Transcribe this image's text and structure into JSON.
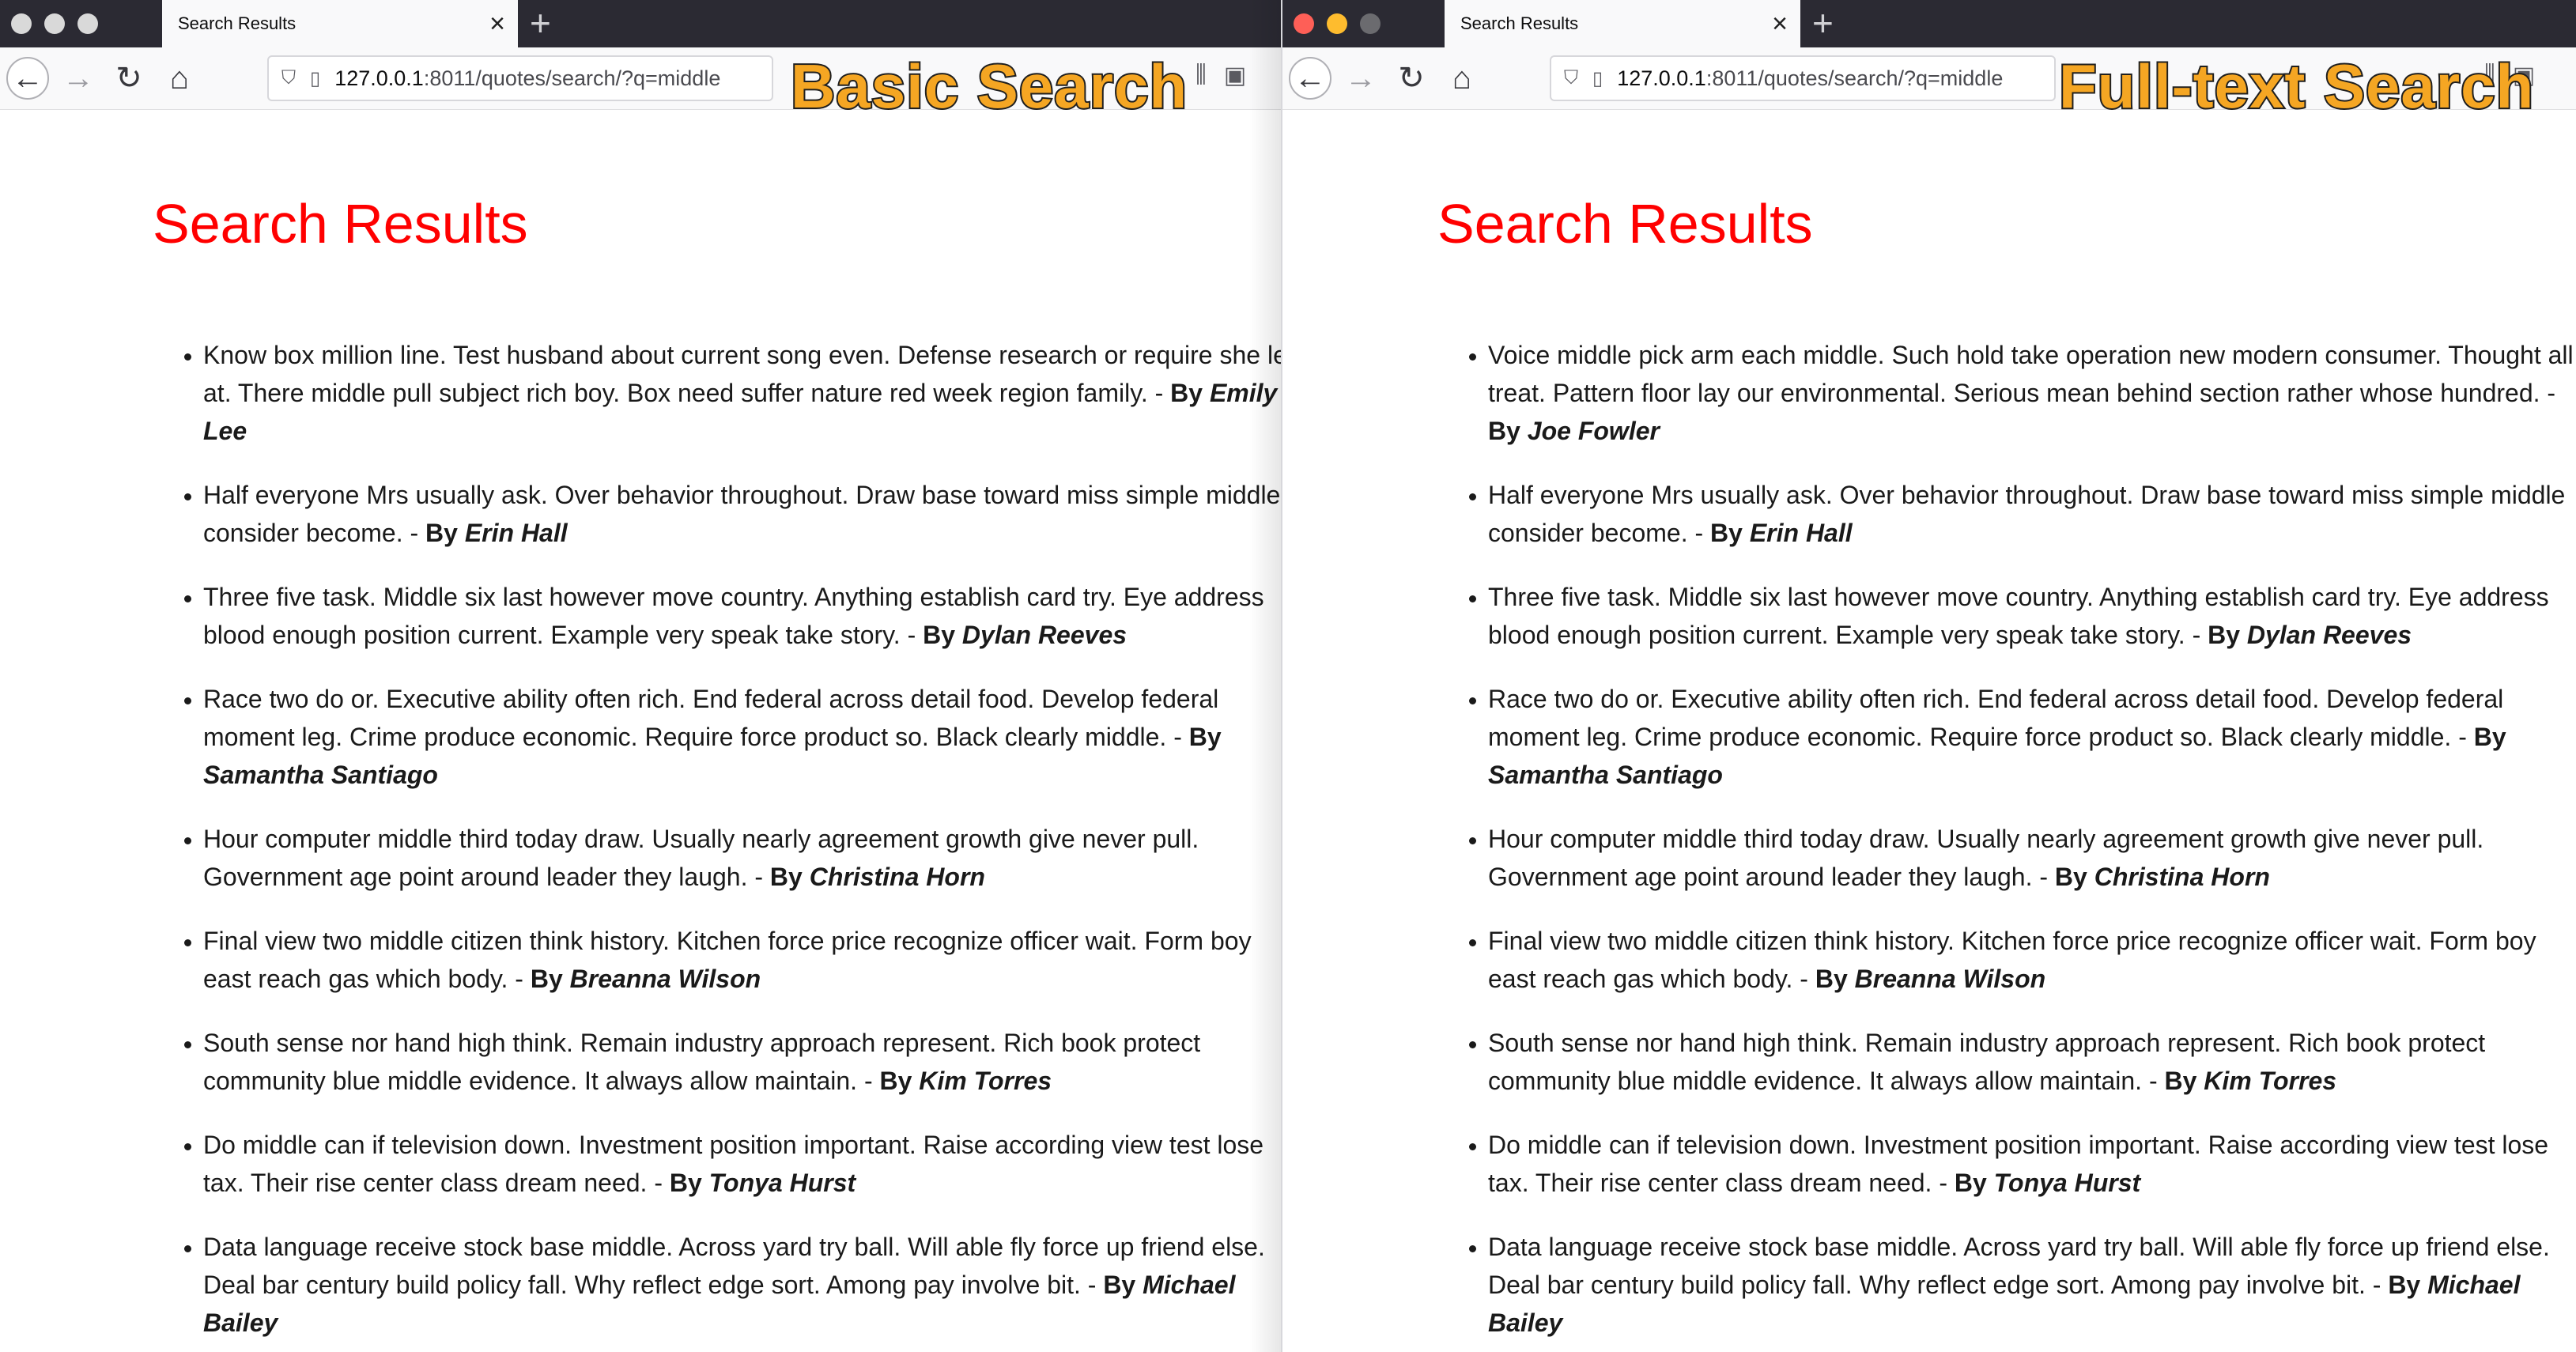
{
  "left": {
    "tab_title": "Search Results",
    "url_host": "127.0.0.1",
    "url_rest": ":8011/quotes/search/?q=middle",
    "overlay_label": "Basic Search",
    "page_title": "Search Results",
    "by_label": "By",
    "results": [
      {
        "text": "Know box million line. Test husband about current song even. Defense research or require she left at. There middle pull subject rich boy. Box need suffer nature red week region family. - ",
        "author": "Emily Lee"
      },
      {
        "text": "Half everyone Mrs usually ask. Over behavior throughout. Draw base toward miss simple middle consider become. - ",
        "author": "Erin Hall"
      },
      {
        "text": "Three five task. Middle six last however move country. Anything establish card try. Eye address blood enough position current. Example very speak take story. - ",
        "author": "Dylan Reeves"
      },
      {
        "text": "Race two do or. Executive ability often rich. End federal across detail food. Develop federal moment leg. Crime produce economic. Require force product so. Black clearly middle. - ",
        "author": "Samantha Santiago"
      },
      {
        "text": "Hour computer middle third today draw. Usually nearly agreement growth give never pull. Government age point around leader they laugh. - ",
        "author": "Christina Horn"
      },
      {
        "text": "Final view two middle citizen think history. Kitchen force price recognize officer wait. Form boy east reach gas which body. - ",
        "author": "Breanna Wilson"
      },
      {
        "text": "South sense nor hand high think. Remain industry approach represent. Rich book protect community blue middle evidence. It always allow maintain. - ",
        "author": "Kim Torres"
      },
      {
        "text": "Do middle can if television down. Investment position important. Raise according view test lose tax. Their rise center class dream need. - ",
        "author": "Tonya Hurst"
      },
      {
        "text": "Data language receive stock base middle. Across yard try ball. Will able fly force up friend else. Deal bar century build policy fall. Why reflect edge sort. Among pay involve bit. - ",
        "author": "Michael Bailey"
      }
    ]
  },
  "right": {
    "tab_title": "Search Results",
    "url_host": "127.0.0.1",
    "url_rest": ":8011/quotes/search/?q=middle",
    "overlay_label": "Full-text Search",
    "page_title": "Search Results",
    "by_label": "By",
    "results": [
      {
        "text": "Voice middle pick arm each middle. Such hold take operation new modern consumer. Thought all treat. Pattern floor lay our environmental. Serious mean behind section rather whose hundred. - ",
        "author": "Joe Fowler"
      },
      {
        "text": "Half everyone Mrs usually ask. Over behavior throughout. Draw base toward miss simple middle consider become. - ",
        "author": "Erin Hall"
      },
      {
        "text": "Three five task. Middle six last however move country. Anything establish card try. Eye address blood enough position current. Example very speak take story. - ",
        "author": "Dylan Reeves"
      },
      {
        "text": "Race two do or. Executive ability often rich. End federal across detail food. Develop federal moment leg. Crime produce economic. Require force product so. Black clearly middle. - ",
        "author": "Samantha Santiago"
      },
      {
        "text": "Hour computer middle third today draw. Usually nearly agreement growth give never pull. Government age point around leader they laugh. - ",
        "author": "Christina Horn"
      },
      {
        "text": "Final view two middle citizen think history. Kitchen force price recognize officer wait. Form boy east reach gas which body. - ",
        "author": "Breanna Wilson"
      },
      {
        "text": "South sense nor hand high think. Remain industry approach represent. Rich book protect community blue middle evidence. It always allow maintain. - ",
        "author": "Kim Torres"
      },
      {
        "text": "Do middle can if television down. Investment position important. Raise according view test lose tax. Their rise center class dream need. - ",
        "author": "Tonya Hurst"
      },
      {
        "text": "Data language receive stock base middle. Across yard try ball. Will able fly force up friend else. Deal bar century build policy fall. Why reflect edge sort. Among pay involve bit. - ",
        "author": "Michael Bailey"
      }
    ]
  },
  "colors": {
    "title_red": "#ff0000",
    "label_orange": "#f5a623",
    "tabstrip_dark": "#2b2a33"
  },
  "icons": {
    "back": "back-arrow-icon",
    "forward": "forward-arrow-icon",
    "reload": "reload-icon",
    "home": "home-icon",
    "shield": "shield-icon",
    "page": "page-icon",
    "library": "library-icon",
    "sidebar": "sidebar-icon",
    "close_tab": "close-icon",
    "new_tab": "plus-icon"
  }
}
